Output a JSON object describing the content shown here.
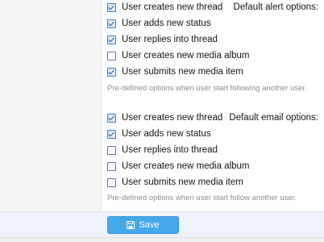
{
  "alert_options": {
    "label": "Default alert options:",
    "items": [
      {
        "label": "User creates new thread",
        "checked": true
      },
      {
        "label": "User adds new status",
        "checked": true
      },
      {
        "label": "User replies into thread",
        "checked": true
      },
      {
        "label": "User creates new media album",
        "checked": false
      },
      {
        "label": "User submits new media item",
        "checked": true
      }
    ],
    "hint": "Pre-defined options when user start following another user."
  },
  "email_options": {
    "label": "Default email options:",
    "items": [
      {
        "label": "User creates new thread",
        "checked": true
      },
      {
        "label": "User adds new status",
        "checked": true
      },
      {
        "label": "User replies into thread",
        "checked": false
      },
      {
        "label": "User creates new media album",
        "checked": false
      },
      {
        "label": "User submits new media item",
        "checked": false
      }
    ],
    "hint": "Pre-defined options when user start follow another user."
  },
  "footer": {
    "save_label": "Save",
    "save_icon": "floppy-disk-icon"
  },
  "colors": {
    "checkbox_border": "#4a7ab6",
    "button_bg": "#47a7eb",
    "footer_bg": "#eef3f9"
  }
}
